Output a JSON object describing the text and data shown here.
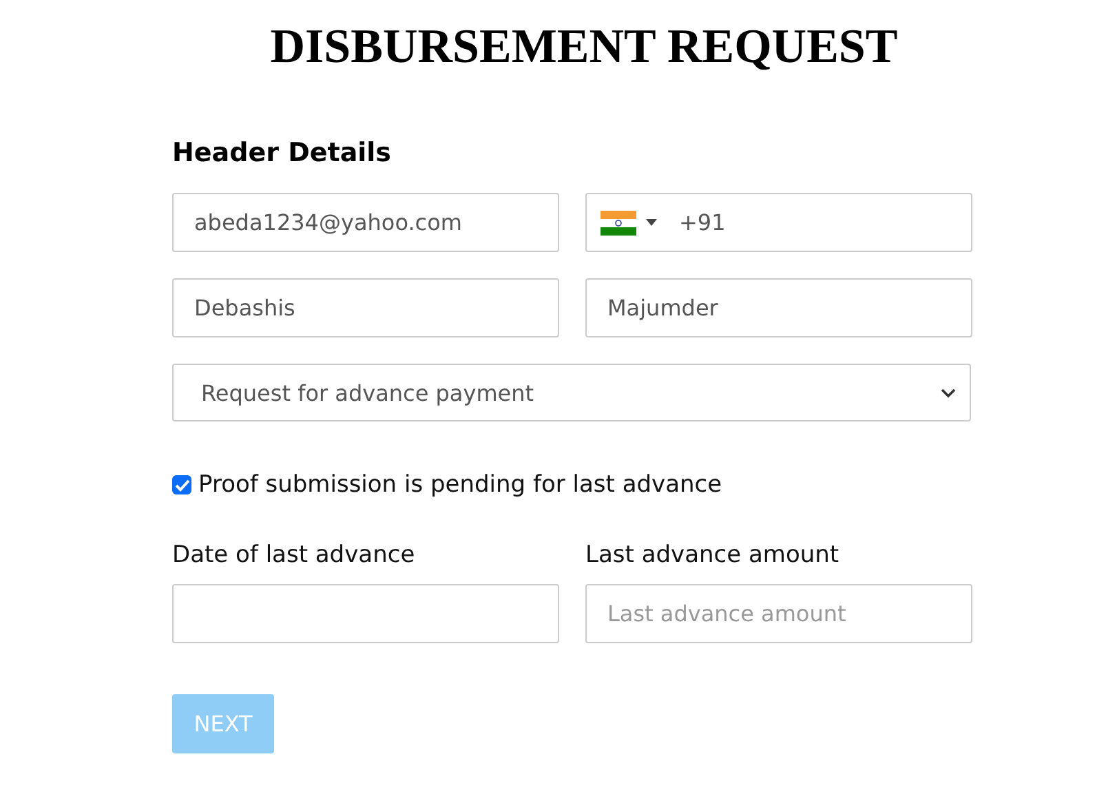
{
  "title": "DISBURSEMENT REQUEST",
  "section_heading": "Header Details",
  "rows": [
    {
      "fields": [
        {
          "kind": "text",
          "value": "abeda1234@yahoo.com"
        },
        {
          "kind": "phone",
          "value": "+91"
        }
      ]
    },
    {
      "fields": [
        {
          "kind": "text",
          "value": "Debashis"
        },
        {
          "kind": "text",
          "value": "Majumder"
        }
      ]
    },
    {
      "fields": [
        {
          "kind": "select",
          "value": "Request for advance payment"
        }
      ]
    }
  ],
  "checkbox": {
    "label": "Proof submission is pending for last advance",
    "checked": true
  },
  "advance_fields": [
    {
      "label": "Date of last advance"
    },
    {
      "label": "Last advance amount",
      "placeholder": "Last advance amount"
    }
  ],
  "next_button": {
    "label": "NEXT",
    "disabled": true
  }
}
